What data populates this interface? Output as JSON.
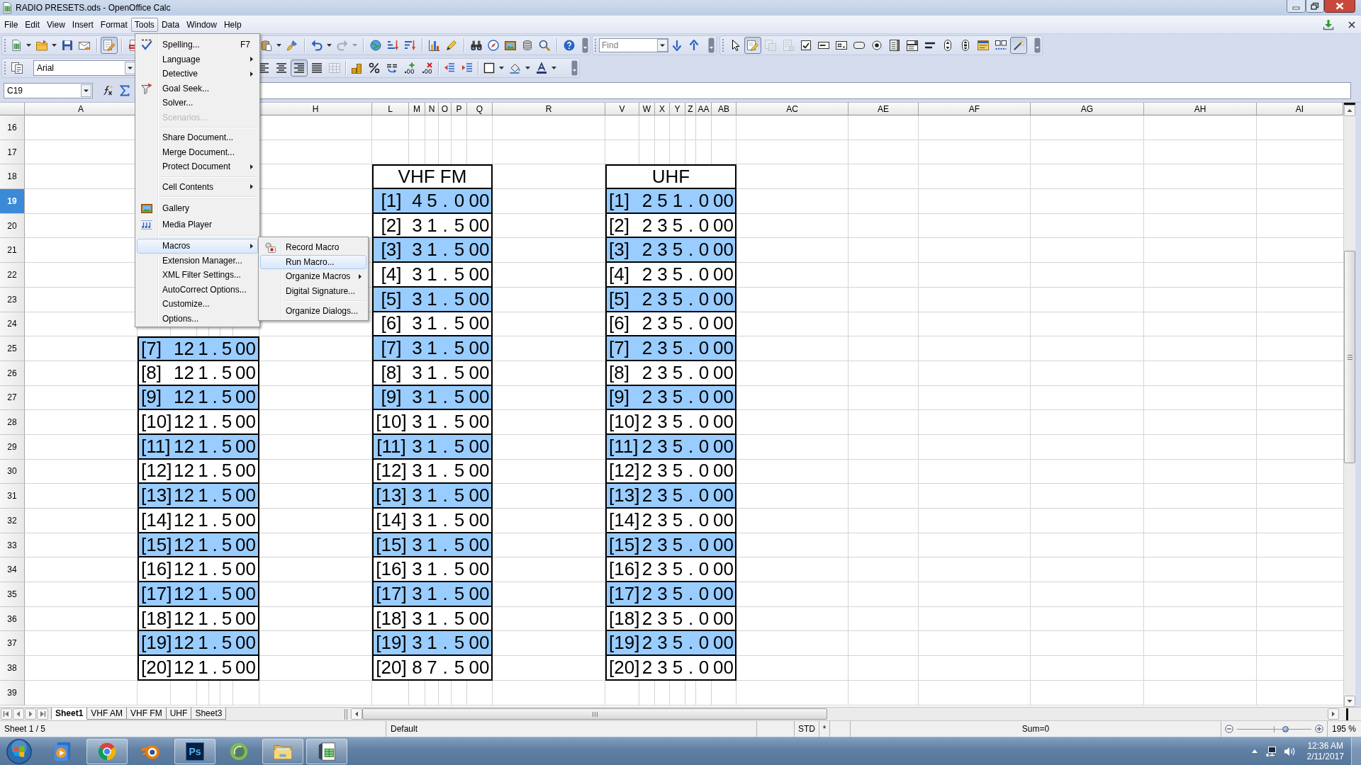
{
  "window": {
    "title": "RADIO PRESETS.ods - OpenOffice Calc"
  },
  "menu_bar": [
    {
      "label": "File",
      "selected": false
    },
    {
      "label": "Edit",
      "selected": false
    },
    {
      "label": "View",
      "selected": false
    },
    {
      "label": "Insert",
      "selected": false
    },
    {
      "label": "Format",
      "selected": false
    },
    {
      "label": "Tools",
      "selected": true
    },
    {
      "label": "Data",
      "selected": false
    },
    {
      "label": "Window",
      "selected": false
    },
    {
      "label": "Help",
      "selected": false
    }
  ],
  "standard_toolbar": [
    {
      "pressed": false,
      "disabled": false
    },
    {
      "pressed": false,
      "disabled": false
    },
    {
      "pressed": false,
      "disabled": false
    },
    {
      "pressed": false,
      "disabled": false
    },
    {
      "pressed": true,
      "disabled": false
    },
    {
      "pressed": false,
      "disabled": false
    },
    {
      "pressed": false,
      "disabled": false
    },
    {
      "pressed": false,
      "disabled": false
    },
    {
      "pressed": false,
      "disabled": false
    },
    {
      "pressed": false,
      "disabled": true
    },
    {
      "pressed": false,
      "disabled": false
    },
    {
      "pressed": false,
      "disabled": false
    },
    {
      "pressed": false,
      "disabled": false
    },
    {
      "pressed": false,
      "disabled": false
    },
    {
      "pressed": false,
      "disabled": false
    },
    {
      "pressed": false,
      "disabled": false
    },
    {
      "pressed": false,
      "disabled": false
    },
    {
      "pressed": false,
      "disabled": false
    },
    {
      "pressed": false,
      "disabled": false
    },
    {
      "pressed": false,
      "disabled": false
    },
    {
      "pressed": false,
      "disabled": false
    }
  ],
  "find_toolbar": {
    "placeholder": "Find"
  },
  "form_controls_toolbar": [
    {
      "pressed": false,
      "disabled": false
    },
    {
      "pressed": true,
      "disabled": false
    },
    {
      "pressed": false,
      "disabled": true
    },
    {
      "pressed": false,
      "disabled": true
    },
    {
      "pressed": false,
      "disabled": false
    },
    {
      "pressed": false,
      "disabled": false
    },
    {
      "pressed": false,
      "disabled": false
    },
    {
      "pressed": false,
      "disabled": false
    },
    {
      "pressed": false,
      "disabled": false
    },
    {
      "pressed": false,
      "disabled": false
    },
    {
      "pressed": false,
      "disabled": false
    },
    {
      "pressed": false,
      "disabled": false
    },
    {
      "pressed": false,
      "disabled": false
    },
    {
      "pressed": false,
      "disabled": false
    },
    {
      "pressed": false,
      "disabled": false
    },
    {
      "pressed": false,
      "disabled": false
    },
    {
      "pressed": true,
      "disabled": false
    }
  ],
  "formatting_toolbar": {
    "font_name": "Arial",
    "buttons": [
      {
        "pressed": false,
        "disabled": false
      },
      {
        "pressed": false,
        "disabled": false
      },
      {
        "pressed": false,
        "disabled": false
      },
      {
        "pressed": true,
        "disabled": false
      },
      {
        "pressed": false,
        "disabled": false
      },
      {
        "pressed": false,
        "disabled": true
      },
      {
        "pressed": false,
        "disabled": false
      },
      {
        "pressed": false,
        "disabled": false
      },
      {
        "pressed": false,
        "disabled": false
      },
      {
        "pressed": false,
        "disabled": false
      },
      {
        "pressed": false,
        "disabled": false
      },
      {
        "pressed": false,
        "disabled": false
      },
      {
        "pressed": false,
        "disabled": false
      },
      {
        "pressed": false,
        "disabled": false
      },
      {
        "pressed": false,
        "disabled": false
      },
      {
        "pressed": false,
        "disabled": false
      }
    ]
  },
  "formula_bar": {
    "name_box": "C19"
  },
  "sheet": {
    "column_headers": [
      "A",
      "H",
      "L",
      "M",
      "N",
      "O",
      "P",
      "Q",
      "R",
      "V",
      "W",
      "X",
      "Y",
      "Z",
      "AA",
      "AB",
      "AC",
      "AE",
      "AF",
      "AG",
      "AH",
      "AI"
    ],
    "rows": [
      {
        "label": "16",
        "selected": false
      },
      {
        "label": "17",
        "selected": false
      },
      {
        "label": "18",
        "selected": false
      },
      {
        "label": "19",
        "selected": true
      },
      {
        "label": "20",
        "selected": false
      },
      {
        "label": "21",
        "selected": false
      },
      {
        "label": "22",
        "selected": false
      },
      {
        "label": "23",
        "selected": false
      },
      {
        "label": "24",
        "selected": false
      },
      {
        "label": "25",
        "selected": false
      },
      {
        "label": "26",
        "selected": false
      },
      {
        "label": "27",
        "selected": false
      },
      {
        "label": "28",
        "selected": false
      },
      {
        "label": "29",
        "selected": false
      },
      {
        "label": "30",
        "selected": false
      },
      {
        "label": "31",
        "selected": false
      },
      {
        "label": "32",
        "selected": false
      },
      {
        "label": "33",
        "selected": false
      },
      {
        "label": "34",
        "selected": false
      },
      {
        "label": "35",
        "selected": false
      },
      {
        "label": "36",
        "selected": false
      },
      {
        "label": "37",
        "selected": false
      },
      {
        "label": "38",
        "selected": false
      },
      {
        "label": "39",
        "selected": false
      }
    ],
    "tables": [
      {
        "rows": [
          {
            "cells": [
              "[7]",
              "12",
              "1",
              ".",
              "5",
              "00"
            ],
            "shaded": true
          },
          {
            "cells": [
              "[8]",
              "12",
              "1",
              ".",
              "5",
              "00"
            ],
            "shaded": false
          },
          {
            "cells": [
              "[9]",
              "12",
              "1",
              ".",
              "5",
              "00"
            ],
            "shaded": true
          },
          {
            "cells": [
              "[10]",
              "12",
              "1",
              ".",
              "5",
              "00"
            ],
            "shaded": false
          },
          {
            "cells": [
              "[11]",
              "12",
              "1",
              ".",
              "5",
              "00"
            ],
            "shaded": true
          },
          {
            "cells": [
              "[12]",
              "12",
              "1",
              ".",
              "5",
              "00"
            ],
            "shaded": false
          },
          {
            "cells": [
              "[13]",
              "12",
              "1",
              ".",
              "5",
              "00"
            ],
            "shaded": true
          },
          {
            "cells": [
              "[14]",
              "12",
              "1",
              ".",
              "5",
              "00"
            ],
            "shaded": false
          },
          {
            "cells": [
              "[15]",
              "12",
              "1",
              ".",
              "5",
              "00"
            ],
            "shaded": true
          },
          {
            "cells": [
              "[16]",
              "12",
              "1",
              ".",
              "5",
              "00"
            ],
            "shaded": false
          },
          {
            "cells": [
              "[17]",
              "12",
              "1",
              ".",
              "5",
              "00"
            ],
            "shaded": true
          },
          {
            "cells": [
              "[18]",
              "12",
              "1",
              ".",
              "5",
              "00"
            ],
            "shaded": false
          },
          {
            "cells": [
              "[19]",
              "12",
              "1",
              ".",
              "5",
              "00"
            ],
            "shaded": true
          },
          {
            "cells": [
              "[20]",
              "12",
              "1",
              ".",
              "5",
              "00"
            ],
            "shaded": false
          }
        ]
      },
      {
        "title": "VHF FM",
        "rows": [
          {
            "cells": [
              "[1]",
              "4",
              "5",
              ".",
              "0",
              "00"
            ],
            "shaded": true
          },
          {
            "cells": [
              "[2]",
              "3",
              "1",
              ".",
              "5",
              "00"
            ],
            "shaded": false
          },
          {
            "cells": [
              "[3]",
              "3",
              "1",
              ".",
              "5",
              "00"
            ],
            "shaded": true
          },
          {
            "cells": [
              "[4]",
              "3",
              "1",
              ".",
              "5",
              "00"
            ],
            "shaded": false
          },
          {
            "cells": [
              "[5]",
              "3",
              "1",
              ".",
              "5",
              "00"
            ],
            "shaded": true
          },
          {
            "cells": [
              "[6]",
              "3",
              "1",
              ".",
              "5",
              "00"
            ],
            "shaded": false
          },
          {
            "cells": [
              "[7]",
              "3",
              "1",
              ".",
              "5",
              "00"
            ],
            "shaded": true
          },
          {
            "cells": [
              "[8]",
              "3",
              "1",
              ".",
              "5",
              "00"
            ],
            "shaded": false
          },
          {
            "cells": [
              "[9]",
              "3",
              "1",
              ".",
              "5",
              "00"
            ],
            "shaded": true
          },
          {
            "cells": [
              "[10]",
              "3",
              "1",
              ".",
              "5",
              "00"
            ],
            "shaded": false
          },
          {
            "cells": [
              "[11]",
              "3",
              "1",
              ".",
              "5",
              "00"
            ],
            "shaded": true
          },
          {
            "cells": [
              "[12]",
              "3",
              "1",
              ".",
              "5",
              "00"
            ],
            "shaded": false
          },
          {
            "cells": [
              "[13]",
              "3",
              "1",
              ".",
              "5",
              "00"
            ],
            "shaded": true
          },
          {
            "cells": [
              "[14]",
              "3",
              "1",
              ".",
              "5",
              "00"
            ],
            "shaded": false
          },
          {
            "cells": [
              "[15]",
              "3",
              "1",
              ".",
              "5",
              "00"
            ],
            "shaded": true
          },
          {
            "cells": [
              "[16]",
              "3",
              "1",
              ".",
              "5",
              "00"
            ],
            "shaded": false
          },
          {
            "cells": [
              "[17]",
              "3",
              "1",
              ".",
              "5",
              "00"
            ],
            "shaded": true
          },
          {
            "cells": [
              "[18]",
              "3",
              "1",
              ".",
              "5",
              "00"
            ],
            "shaded": false
          },
          {
            "cells": [
              "[19]",
              "3",
              "1",
              ".",
              "5",
              "00"
            ],
            "shaded": true
          },
          {
            "cells": [
              "[20]",
              "8",
              "7",
              ".",
              "5",
              "00"
            ],
            "shaded": false
          }
        ]
      },
      {
        "title": "UHF",
        "rows": [
          {
            "cells": [
              "[1]",
              "2",
              "5",
              "1",
              ".",
              "0",
              "00"
            ],
            "shaded": true
          },
          {
            "cells": [
              "[2]",
              "2",
              "3",
              "5",
              ".",
              "0",
              "00"
            ],
            "shaded": false
          },
          {
            "cells": [
              "[3]",
              "2",
              "3",
              "5",
              ".",
              "0",
              "00"
            ],
            "shaded": true
          },
          {
            "cells": [
              "[4]",
              "2",
              "3",
              "5",
              ".",
              "0",
              "00"
            ],
            "shaded": false
          },
          {
            "cells": [
              "[5]",
              "2",
              "3",
              "5",
              ".",
              "0",
              "00"
            ],
            "shaded": true
          },
          {
            "cells": [
              "[6]",
              "2",
              "3",
              "5",
              ".",
              "0",
              "00"
            ],
            "shaded": false
          },
          {
            "cells": [
              "[7]",
              "2",
              "3",
              "5",
              ".",
              "0",
              "00"
            ],
            "shaded": true
          },
          {
            "cells": [
              "[8]",
              "2",
              "3",
              "5",
              ".",
              "0",
              "00"
            ],
            "shaded": false
          },
          {
            "cells": [
              "[9]",
              "2",
              "3",
              "5",
              ".",
              "0",
              "00"
            ],
            "shaded": true
          },
          {
            "cells": [
              "[10]",
              "2",
              "3",
              "5",
              ".",
              "0",
              "00"
            ],
            "shaded": false
          },
          {
            "cells": [
              "[11]",
              "2",
              "3",
              "5",
              ".",
              "0",
              "00"
            ],
            "shaded": true
          },
          {
            "cells": [
              "[12]",
              "2",
              "3",
              "5",
              ".",
              "0",
              "00"
            ],
            "shaded": false
          },
          {
            "cells": [
              "[13]",
              "2",
              "3",
              "5",
              ".",
              "0",
              "00"
            ],
            "shaded": true
          },
          {
            "cells": [
              "[14]",
              "2",
              "3",
              "5",
              ".",
              "0",
              "00"
            ],
            "shaded": false
          },
          {
            "cells": [
              "[15]",
              "2",
              "3",
              "5",
              ".",
              "0",
              "00"
            ],
            "shaded": true
          },
          {
            "cells": [
              "[16]",
              "2",
              "3",
              "5",
              ".",
              "0",
              "00"
            ],
            "shaded": false
          },
          {
            "cells": [
              "[17]",
              "2",
              "3",
              "5",
              ".",
              "0",
              "00"
            ],
            "shaded": true
          },
          {
            "cells": [
              "[18]",
              "2",
              "3",
              "5",
              ".",
              "0",
              "00"
            ],
            "shaded": false
          },
          {
            "cells": [
              "[19]",
              "2",
              "3",
              "5",
              ".",
              "0",
              "00"
            ],
            "shaded": true
          },
          {
            "cells": [
              "[20]",
              "2",
              "3",
              "5",
              ".",
              "0",
              "00"
            ],
            "shaded": false
          }
        ]
      }
    ]
  },
  "tools_menu": {
    "groups": [
      [
        {
          "label": "Spelling...",
          "shortcut": "F7",
          "submenu": false,
          "disabled": false,
          "selected": false
        },
        {
          "label": "Language",
          "submenu": true,
          "disabled": false,
          "selected": false
        },
        {
          "label": "Detective",
          "submenu": true,
          "disabled": false,
          "selected": false
        },
        {
          "label": "Goal Seek...",
          "submenu": false,
          "disabled": false,
          "selected": false
        },
        {
          "label": "Solver...",
          "submenu": false,
          "disabled": false,
          "selected": false
        },
        {
          "label": "Scenarios...",
          "submenu": false,
          "disabled": true,
          "selected": false
        }
      ],
      [
        {
          "label": "Share Document...",
          "submenu": false,
          "disabled": false,
          "selected": false
        },
        {
          "label": "Merge Document...",
          "submenu": false,
          "disabled": false,
          "selected": false
        },
        {
          "label": "Protect Document",
          "submenu": true,
          "disabled": false,
          "selected": false
        }
      ],
      [
        {
          "label": "Cell Contents",
          "submenu": true,
          "disabled": false,
          "selected": false
        }
      ],
      [
        {
          "label": "Gallery",
          "submenu": false,
          "disabled": false,
          "selected": false
        },
        {
          "label": "Media Player",
          "submenu": false,
          "disabled": false,
          "selected": false
        }
      ],
      [
        {
          "label": "Macros",
          "submenu": true,
          "disabled": false,
          "selected": true
        },
        {
          "label": "Extension Manager...",
          "submenu": false,
          "disabled": false,
          "selected": false
        },
        {
          "label": "XML Filter Settings...",
          "submenu": false,
          "disabled": false,
          "selected": false
        },
        {
          "label": "AutoCorrect Options...",
          "submenu": false,
          "disabled": false,
          "selected": false
        },
        {
          "label": "Customize...",
          "submenu": false,
          "disabled": false,
          "selected": false
        },
        {
          "label": "Options...",
          "submenu": false,
          "disabled": false,
          "selected": false
        }
      ]
    ]
  },
  "macros_submenu": {
    "groups": [
      [
        {
          "label": "Record Macro",
          "submenu": false,
          "disabled": false,
          "selected": false
        },
        {
          "label": "Run Macro...",
          "submenu": false,
          "disabled": false,
          "selected": true
        },
        {
          "label": "Organize Macros",
          "submenu": true,
          "disabled": false,
          "selected": false
        },
        {
          "label": "Digital Signature...",
          "submenu": false,
          "disabled": false,
          "selected": false
        }
      ],
      [
        {
          "label": "Organize Dialogs...",
          "submenu": false,
          "disabled": false,
          "selected": false
        }
      ]
    ]
  },
  "sheet_tabs": [
    {
      "label": "Sheet1",
      "selected": true
    },
    {
      "label": "VHF AM",
      "selected": false
    },
    {
      "label": "VHF FM",
      "selected": false
    },
    {
      "label": "UHF",
      "selected": false
    },
    {
      "label": "Sheet3",
      "selected": false
    }
  ],
  "status_bar": {
    "sheet": "Sheet 1 / 5",
    "page_style": "Default",
    "selection_mode": "STD",
    "modified": "*",
    "sum": "Sum=0",
    "zoom_slider": {
      "level": 0.65
    },
    "zoom": "195 %"
  },
  "taskbar": {
    "apps": [
      {
        "running": false
      },
      {
        "running": true
      },
      {
        "running": false
      },
      {
        "running": true,
        "label": "Ps"
      },
      {
        "running": false
      },
      {
        "running": true
      },
      {
        "running": true
      }
    ],
    "clock": {
      "time": "12:36 AM",
      "date": "2/11/2017"
    }
  }
}
